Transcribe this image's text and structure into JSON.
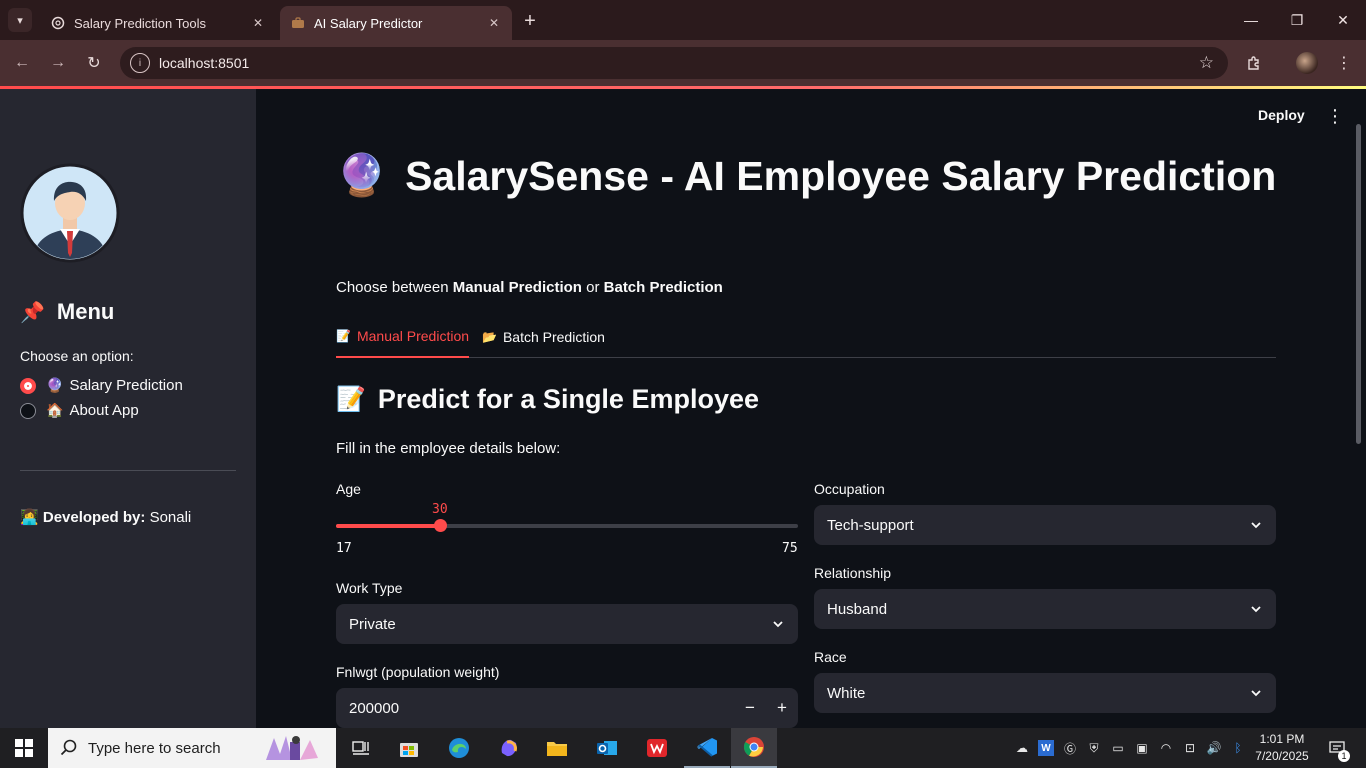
{
  "browser": {
    "tabs": [
      {
        "title": "Salary Prediction Tools",
        "active": false,
        "icon": "openai-icon"
      },
      {
        "title": "AI Salary Predictor",
        "active": true,
        "icon": "briefcase-icon"
      }
    ],
    "url": "localhost:8501"
  },
  "sidebar": {
    "menu_title": "Menu",
    "menu_icon": "pushpin-icon",
    "choose_label": "Choose an option:",
    "options": [
      {
        "emoji": "🔮",
        "label": "Salary Prediction",
        "selected": true
      },
      {
        "emoji": "🏠",
        "label": "About App",
        "selected": false
      }
    ],
    "developed_by_label": "Developed by:",
    "developer": "Sonali"
  },
  "header": {
    "deploy_label": "Deploy"
  },
  "main": {
    "title_emoji": "🔮",
    "title": "SalarySense - AI Employee Salary Prediction",
    "choose_prefix": "Choose between",
    "choose_option1": "Manual Prediction",
    "choose_or": "or",
    "choose_option2": "Batch Prediction",
    "tabs": [
      {
        "emoji": "📝",
        "label": "Manual Prediction",
        "active": true
      },
      {
        "emoji": "📂",
        "label": "Batch Prediction",
        "active": false
      }
    ],
    "section_emoji": "📝",
    "section_title": "Predict for a Single Employee",
    "fill_text": "Fill in the employee details below:",
    "age": {
      "label": "Age",
      "value": 30,
      "min": 17,
      "max": 75
    },
    "work_type": {
      "label": "Work Type",
      "value": "Private"
    },
    "fnlwgt": {
      "label": "Fnlwgt (population weight)",
      "value": "200000"
    },
    "occupation": {
      "label": "Occupation",
      "value": "Tech-support"
    },
    "relationship": {
      "label": "Relationship",
      "value": "Husband"
    },
    "race": {
      "label": "Race",
      "value": "White"
    }
  },
  "taskbar": {
    "search_placeholder": "Type here to search",
    "time": "1:01 PM",
    "date": "7/20/2025",
    "notification_count": "1"
  },
  "colors": {
    "accent": "#ff4b4b",
    "background": "#0e1117",
    "sidebar": "#262730"
  }
}
